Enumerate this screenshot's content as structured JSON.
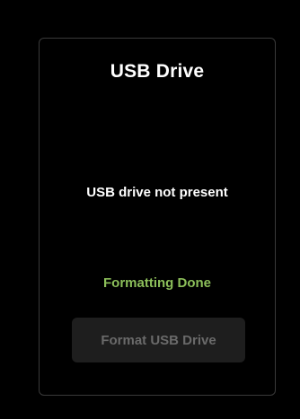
{
  "panel": {
    "title": "USB Drive",
    "status_text": "USB drive not present",
    "result_text": "Formatting Done",
    "format_button_label": "Format USB Drive",
    "format_button_enabled": false
  },
  "colors": {
    "background": "#000000",
    "panel_border": "#3a3a3a",
    "text_primary": "#ffffff",
    "success": "#8cbf5a",
    "button_bg_disabled": "#1e1e1e",
    "button_text_disabled": "#6a6a6a"
  }
}
